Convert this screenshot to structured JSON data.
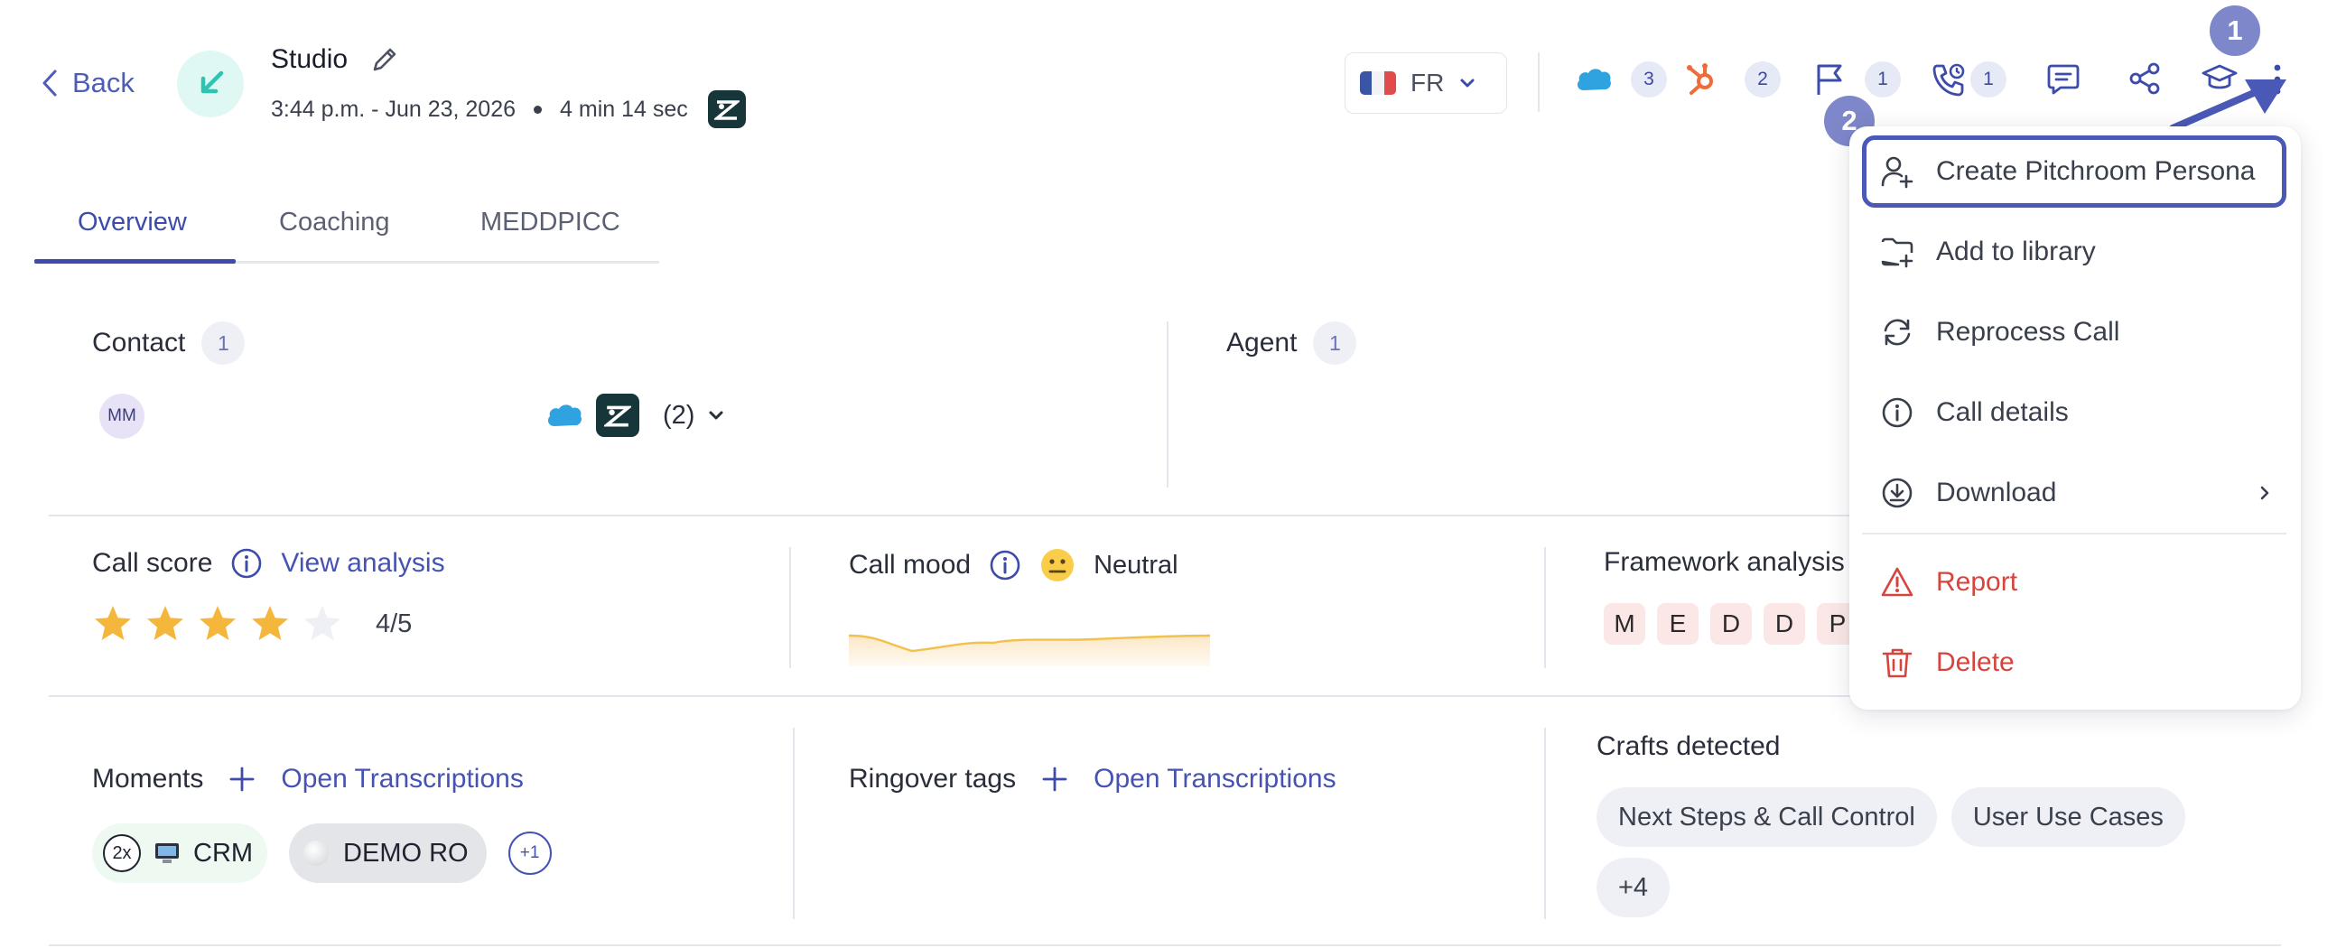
{
  "header": {
    "back_label": "Back",
    "title": "Studio",
    "time": "3:44 p.m. - Jun 23, 2026",
    "duration": "4 min 14 sec",
    "language": "FR",
    "counts": {
      "salesforce": "3",
      "hubspot": "2",
      "flags": "1",
      "calls": "1"
    }
  },
  "annotations": {
    "step1": "1",
    "step2": "2"
  },
  "tabs": [
    {
      "label": "Overview",
      "active": true
    },
    {
      "label": "Coaching",
      "active": false
    },
    {
      "label": "MEDDPICC",
      "active": false
    }
  ],
  "contact": {
    "label": "Contact",
    "count": "1",
    "avatar_initials": "MM",
    "more_count": "(2)"
  },
  "agent": {
    "label": "Agent",
    "count": "1"
  },
  "call_score": {
    "label": "Call score",
    "link": "View analysis",
    "rating": 4,
    "max": 5,
    "display": "4/5"
  },
  "call_mood": {
    "label": "Call mood",
    "value": "Neutral"
  },
  "framework": {
    "label": "Framework analysis",
    "letters": [
      "M",
      "E",
      "D",
      "D",
      "P"
    ]
  },
  "moments": {
    "label": "Moments",
    "link": "Open Transcriptions",
    "tags": [
      {
        "count": "2x",
        "label": "CRM"
      },
      {
        "label": "DEMO RO"
      }
    ],
    "extra": "+1"
  },
  "ringover_tags": {
    "label": "Ringover tags",
    "link": "Open Transcriptions"
  },
  "crafts": {
    "label": "Crafts detected",
    "items": [
      "Next Steps & Call Control",
      "User Use Cases"
    ],
    "extra": "+4"
  },
  "menu": {
    "items": [
      {
        "label": "Create Pitchroom Persona",
        "icon": "user-plus-icon"
      },
      {
        "label": "Add to library",
        "icon": "folder-plus-icon"
      },
      {
        "label": "Reprocess Call",
        "icon": "refresh-icon"
      },
      {
        "label": "Call details",
        "icon": "info-icon"
      },
      {
        "label": "Download",
        "icon": "download-icon"
      },
      {
        "label": "Report",
        "icon": "warning-icon"
      },
      {
        "label": "Delete",
        "icon": "trash-icon"
      }
    ]
  },
  "colors": {
    "accent": "#3d4cab",
    "danger": "#d6453d",
    "annotation": "#7e87c9",
    "star": "#f5b73b"
  }
}
